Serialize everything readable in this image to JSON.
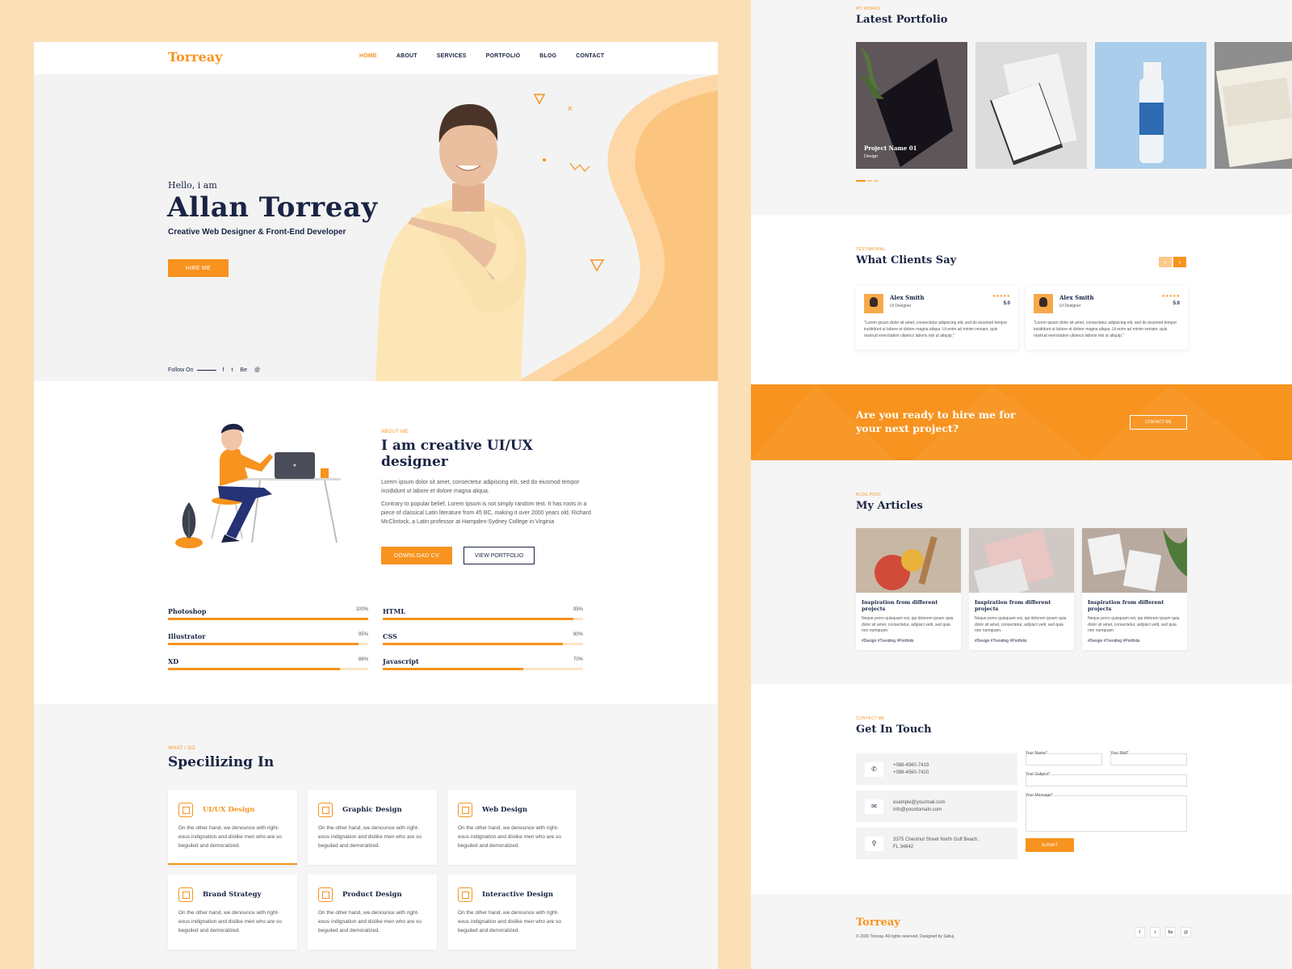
{
  "left": {
    "logo": "Torreay",
    "nav": [
      "HOME",
      "ABOUT",
      "SERVICES",
      "PORTFOLIO",
      "BLOG",
      "CONTACT"
    ],
    "hero": {
      "greeting": "Hello, i am",
      "name": "Allan Torreay",
      "role": "Creative Web Designer & Front-End Developer",
      "hire_label": "HIRE ME",
      "follow_label": "Follow On",
      "social": [
        "f",
        "t",
        "Be",
        "@"
      ]
    },
    "about": {
      "label": "ABOUT ME",
      "title": "I am creative UI/UX designer",
      "para1": "Lorem ipsum dolor sit amet, consectetur adipiscing elit, sed do eiusmod tempor incididunt ut labore et dolore magna aliqua.",
      "para2": "Contrary to popular belief, Lorem Ipsum is not simply random text. It has roots in a piece of classical Latin literature from 45 BC, making it over 2000 years old. Richard McClintock, a Latin professor at Hampden-Sydney College in Virginia",
      "download_label": "DOWNLOAD CV",
      "portfolio_label": "VIEW PORTFOLIO"
    },
    "skills": [
      {
        "name": "Photoshop",
        "percent": "100%",
        "value": 100
      },
      {
        "name": "HTML",
        "percent": "95%",
        "value": 95
      },
      {
        "name": "Illustrator",
        "percent": "95%",
        "value": 95
      },
      {
        "name": "CSS",
        "percent": "90%",
        "value": 90
      },
      {
        "name": "XD",
        "percent": "86%",
        "value": 86
      },
      {
        "name": "Javascript",
        "percent": "70%",
        "value": 70
      }
    ],
    "specializing": {
      "label": "WHAT I DO",
      "title": "Specilizing In",
      "cards": [
        {
          "title": "UI/UX Design",
          "text": "On the other hand, we denounce with right-eous indignation and dislike men who are so beguiled and demoralized.",
          "selected": true
        },
        {
          "title": "Graphic Design",
          "text": "On the other hand, we denounce with right-eous indignation and dislike men who are so beguiled and demoralized.",
          "selected": false
        },
        {
          "title": "Web Design",
          "text": "On the other hand, we denounce with right-eous indignation and dislike men who are so beguiled and demoralized.",
          "selected": false
        },
        {
          "title": "Brand Strategy",
          "text": "On the other hand, we denounce with right-eous indignation and dislike men who are so beguiled and demoralized.",
          "selected": false
        },
        {
          "title": "Product Design",
          "text": "On the other hand, we denounce with right-eous indignation and dislike men who are so beguiled and demoralized.",
          "selected": false
        },
        {
          "title": "Interactive Design",
          "text": "On the other hand, we denounce with right-eous indignation and dislike men who are so beguiled and demoralized.",
          "selected": false
        }
      ]
    }
  },
  "right": {
    "portfolio": {
      "label": "MY WORKS",
      "title": "Latest Portfolio",
      "items": [
        {
          "name": "Project Name 01",
          "category": "Design",
          "color": "#5e5659"
        },
        {
          "name": "",
          "category": "",
          "color": "#dcdcdc"
        },
        {
          "name": "",
          "category": "",
          "color": "#a9cdeb"
        },
        {
          "name": "",
          "category": "",
          "color": "#8e8e8e"
        }
      ]
    },
    "testimonial": {
      "label": "TESTIMONIAL",
      "title": "What Clients Say",
      "prev": "‹",
      "next": "›",
      "items": [
        {
          "name": "Alex Smith",
          "role": "UI Designer",
          "stars": "★★★★★",
          "rating": "5.0",
          "text": "\"Lorem ipsum dolor sit amet, consectetur adipiscing elit, sed do eiusmod tempor incididunt ut labore et dolore magna aliqua. Ut enim ad minim veniam, quis nostrud exercitation ullamco laboris nisi ut aliquip.\""
        },
        {
          "name": "Alex Smith",
          "role": "UI Designer",
          "stars": "★★★★★",
          "rating": "5.0",
          "text": "\"Lorem ipsum dolor sit amet, consectetur adipiscing elit, sed do eiusmod tempor incididunt ut labore et dolore magna aliqua. Ut enim ad minim veniam, quis nostrud exercitation ullamco laboris nisi ut aliquip.\""
        }
      ]
    },
    "cta": {
      "text": "Are you ready to hire me for your next project?",
      "button": "CONTACT ME"
    },
    "articles": {
      "label": "BLOG POST",
      "title": "My Articles",
      "items": [
        {
          "title": "Inspiration from different projects",
          "text": "Neque porro quisquam est, qui dolorem ipsum quia dolor sit amet, consectetur, adipisci velit, sed quia non numquam.",
          "tags": "#Design #Trending #Portfolio",
          "color": "#c8b7a4"
        },
        {
          "title": "Inspiration from different projects",
          "text": "Neque porro quisquam est, qui dolorem ipsum quia dolor sit amet, consectetur, adipisci velit, sed quia non numquam.",
          "tags": "#Design #Trending #Portfolio",
          "color": "#cfc8c4"
        },
        {
          "title": "Inspiration from different projects",
          "text": "Neque porro quisquam est, qui dolorem ipsum quia dolor sit amet, consectetur, adipisci velit, sed quia non numquam.",
          "tags": "#Design #Trending #Portfolio",
          "color": "#b9aaa0"
        }
      ]
    },
    "contact": {
      "label": "CONTACT ME",
      "title": "Get In Touch",
      "phone1": "+088-4560-7419",
      "phone2": "+088-4560-7420",
      "email1": "example@yourmail.com",
      "email2": "info@yourdomain.com",
      "address1": "3375 Chestnut Street North Gulf Beach,",
      "address2": "FL 34642",
      "name_label": "Your Name*",
      "mail_label": "Your Mail*",
      "subject_label": "Your Subject*",
      "message_label": "Your Message*",
      "submit": "SUBMIT"
    },
    "footer": {
      "logo": "Torreay",
      "copyright": "© 2020 Torreay. All rights reserved. Designed by Sabuj.",
      "social": [
        "f",
        "t",
        "Be",
        "@"
      ]
    }
  },
  "colors": {
    "accent": "#f7931e",
    "navy": "#1a2444",
    "peach": "#fbdfb7"
  }
}
